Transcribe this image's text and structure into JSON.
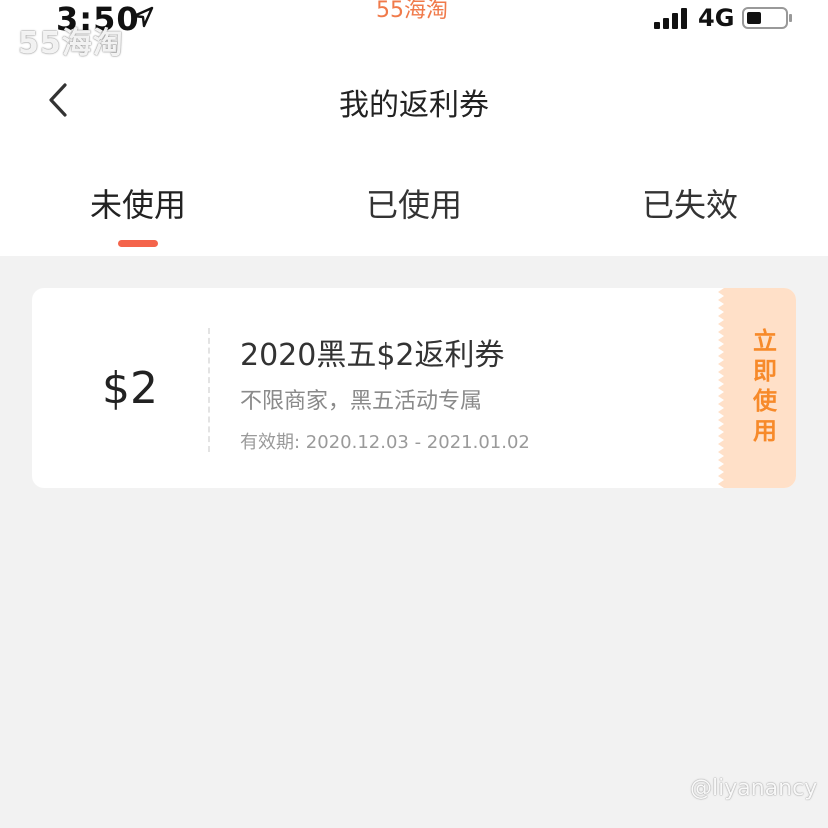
{
  "status_bar": {
    "time": "3:50",
    "center_text": "55海淘",
    "network": "4G"
  },
  "watermark": {
    "logo": "55海淘",
    "user": "@liyanancy"
  },
  "nav": {
    "title": "我的返利券"
  },
  "tabs": [
    {
      "label": "未使用",
      "active": true
    },
    {
      "label": "已使用",
      "active": false
    },
    {
      "label": "已失效",
      "active": false
    }
  ],
  "coupon": {
    "amount": "$2",
    "title": "2020黑五$2返利券",
    "description": "不限商家，黑五活动专属",
    "validity": "有效期: 2020.12.03 - 2021.01.02",
    "action_label": "立即使用"
  },
  "colors": {
    "accent": "#f4644b",
    "action_bg": "#ffe0c8",
    "action_text": "#f78a2a",
    "background": "#f2f2f2"
  }
}
